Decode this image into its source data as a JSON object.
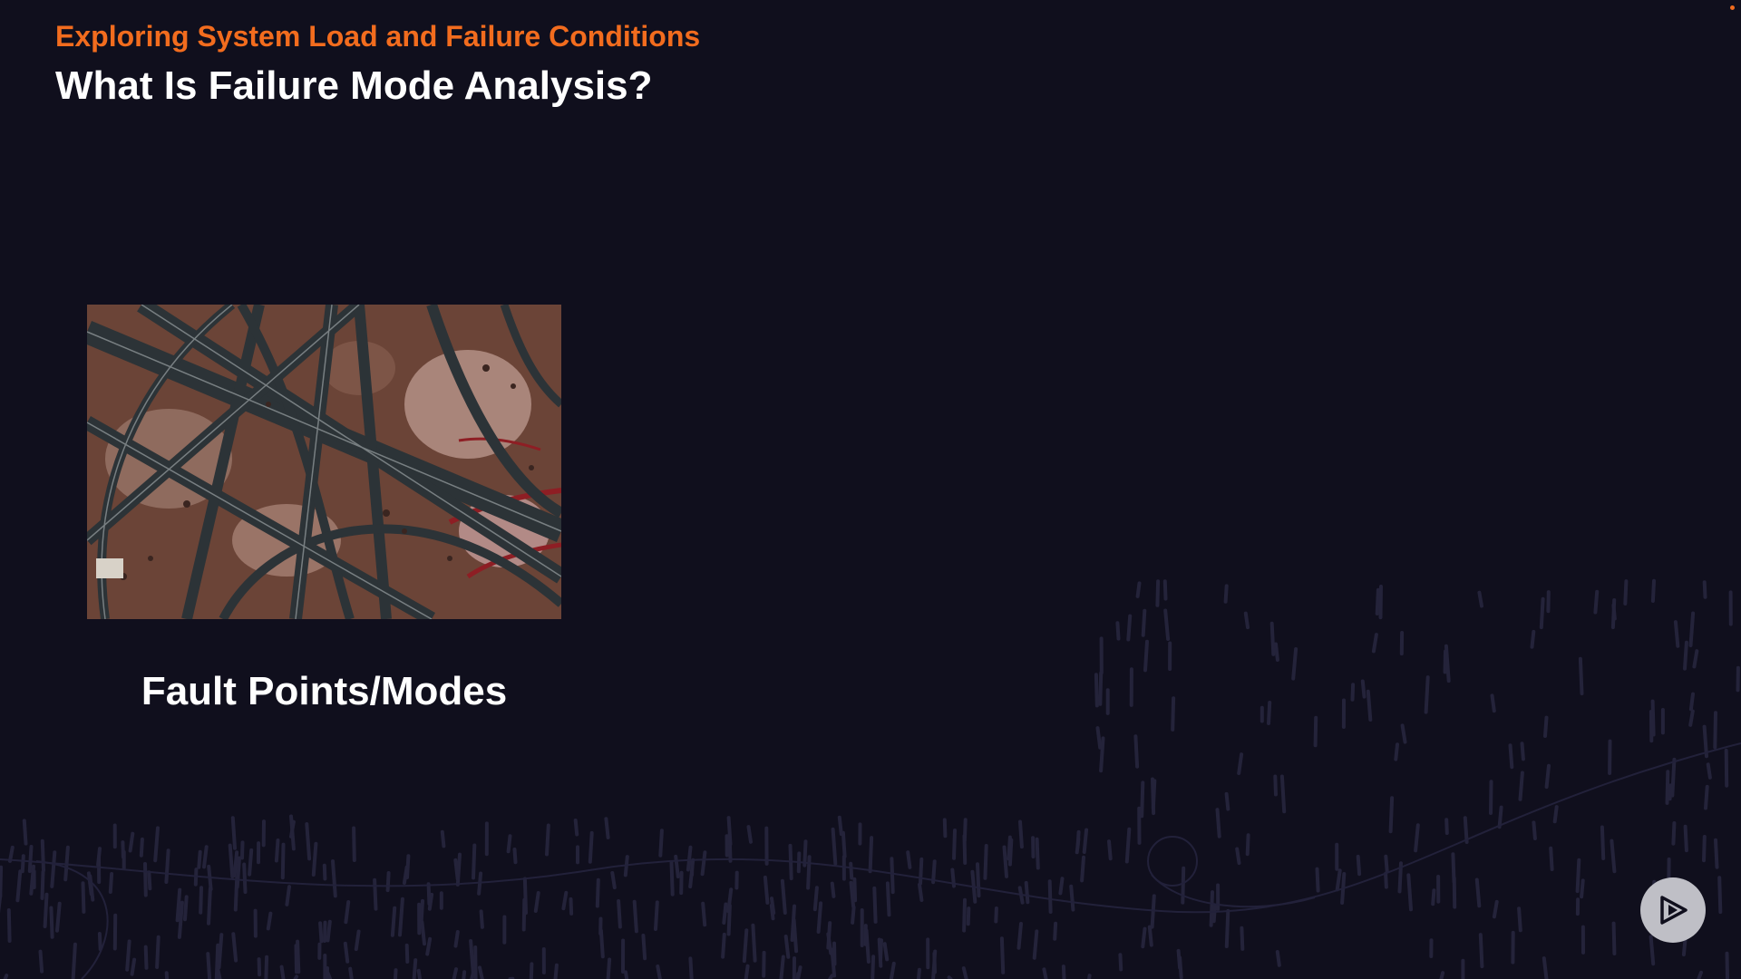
{
  "slide": {
    "kicker": "Exploring System Load and Failure Conditions",
    "title": "What Is Failure Mode Analysis?",
    "figure_caption": "Fault Points/Modes",
    "figure_alt": "Aerial view of highway interchange",
    "icons": {
      "play": "play-icon"
    }
  },
  "colors": {
    "background": "#100f1d",
    "accent": "#f26c1e",
    "text": "#ffffff",
    "play_button": "#bfbfc6"
  }
}
